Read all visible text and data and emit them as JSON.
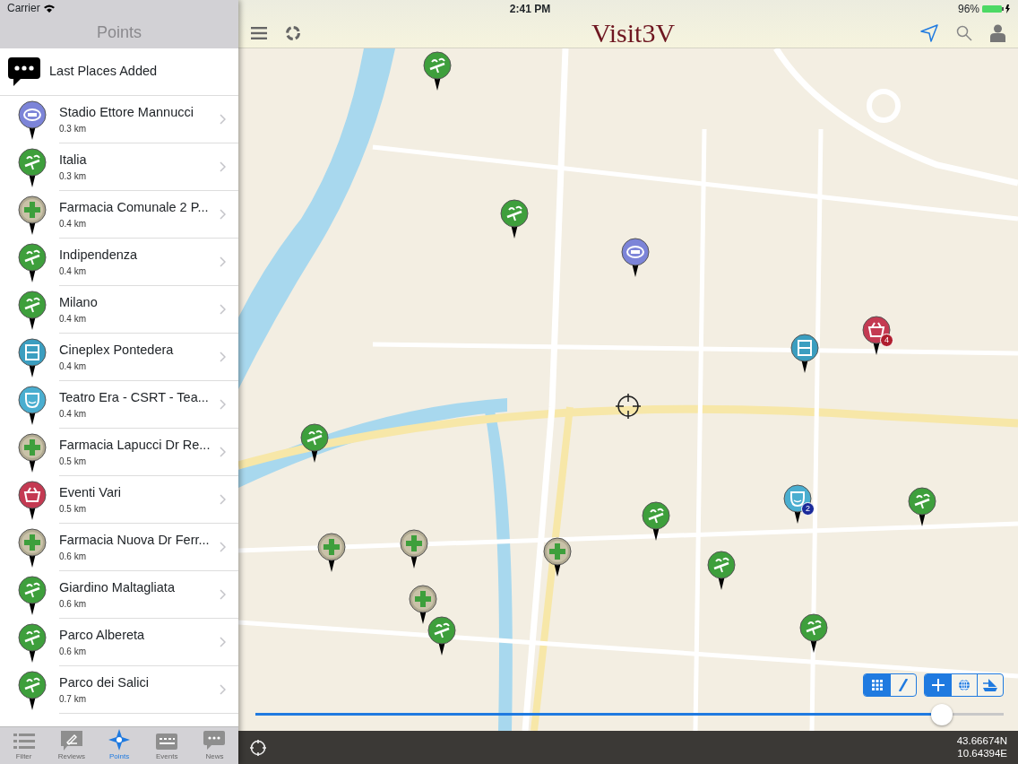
{
  "status_bar": {
    "carrier": "Carrier",
    "time": "2:41 PM",
    "battery": "96%"
  },
  "sidebar": {
    "title": "Points",
    "header": "Last Places Added",
    "items": [
      {
        "name": "Stadio Ettore Mannucci",
        "distance": "0.3 km",
        "kind": "stadium"
      },
      {
        "name": "Italia",
        "distance": "0.3 km",
        "kind": "park"
      },
      {
        "name": "Farmacia Comunale 2 P...",
        "distance": "0.4 km",
        "kind": "pharmacy"
      },
      {
        "name": "Indipendenza",
        "distance": "0.4 km",
        "kind": "park"
      },
      {
        "name": "Milano",
        "distance": "0.4 km",
        "kind": "park"
      },
      {
        "name": "Cineplex Pontedera",
        "distance": "0.4 km",
        "kind": "cinema"
      },
      {
        "name": "Teatro Era - CSRT - Tea...",
        "distance": "0.4 km",
        "kind": "theater"
      },
      {
        "name": "Farmacia Lapucci Dr Re...",
        "distance": "0.5 km",
        "kind": "pharmacy"
      },
      {
        "name": "Eventi Vari",
        "distance": "0.5 km",
        "kind": "events"
      },
      {
        "name": "Farmacia Nuova Dr Ferr...",
        "distance": "0.6 km",
        "kind": "pharmacy"
      },
      {
        "name": "Giardino Maltagliata",
        "distance": "0.6 km",
        "kind": "park"
      },
      {
        "name": "Parco Albereta",
        "distance": "0.6 km",
        "kind": "park"
      },
      {
        "name": "Parco dei Salici",
        "distance": "0.7 km",
        "kind": "park"
      }
    ]
  },
  "tab_bar": [
    {
      "label": "Filter",
      "kind": "list",
      "selected": false
    },
    {
      "label": "Reviews",
      "kind": "reviews",
      "selected": false
    },
    {
      "label": "Points",
      "kind": "points",
      "selected": true
    },
    {
      "label": "Events",
      "kind": "events",
      "selected": false
    },
    {
      "label": "News",
      "kind": "news",
      "selected": false
    }
  ],
  "map": {
    "title": "Visit3V",
    "markers": [
      {
        "kind": "park"
      },
      {
        "kind": "park"
      },
      {
        "kind": "stadium"
      },
      {
        "kind": "events",
        "badge": "4"
      },
      {
        "kind": "cinema"
      },
      {
        "kind": "park"
      },
      {
        "kind": "theater",
        "badge": "2"
      },
      {
        "kind": "park"
      },
      {
        "kind": "park"
      },
      {
        "kind": "pharmacy"
      },
      {
        "kind": "pharmacy"
      },
      {
        "kind": "pharmacy"
      },
      {
        "kind": "park"
      },
      {
        "kind": "pharmacy"
      },
      {
        "kind": "park"
      },
      {
        "kind": "park"
      }
    ],
    "view_modes": [
      {
        "kind": "grid",
        "selected": true
      },
      {
        "kind": "route",
        "selected": false
      }
    ],
    "tools": [
      {
        "kind": "plus",
        "selected": true
      },
      {
        "kind": "globe",
        "selected": false
      },
      {
        "kind": "ship",
        "selected": false
      }
    ],
    "zoom_slider": {
      "level": 0.93
    },
    "coordinates": [
      "43.66674N",
      "10.64394E"
    ]
  }
}
